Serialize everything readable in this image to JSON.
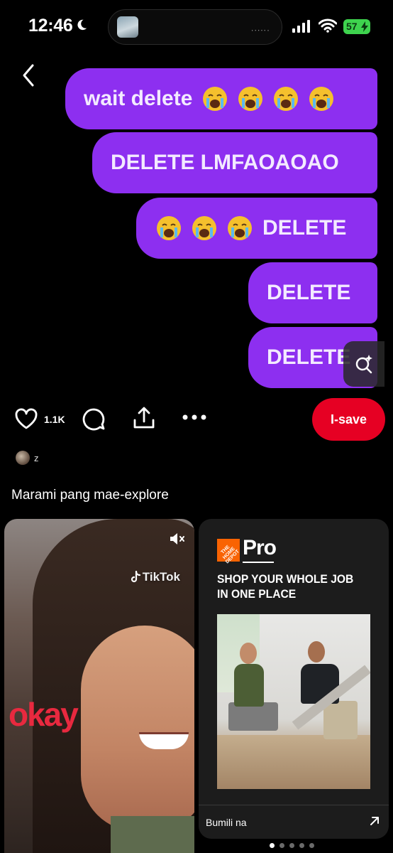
{
  "status_bar": {
    "time": "12:46",
    "battery": "57",
    "icons": [
      "moon-icon",
      "signal-icon",
      "wifi-icon",
      "battery-icon"
    ]
  },
  "pin": {
    "bubbles": [
      {
        "text": "wait delete",
        "emoji_count": 4,
        "emoji_position": "after"
      },
      {
        "text": "DELETE LMFAOAOAO",
        "emoji_count": 0
      },
      {
        "text": "DELETE",
        "emoji_count": 3,
        "emoji_position": "before"
      },
      {
        "text": "DELETE",
        "emoji_count": 0
      },
      {
        "text": "DELETE",
        "emoji_count": 0
      }
    ],
    "bubble_color": "#8d2ff0",
    "emoji": "loudly-crying-face"
  },
  "actions": {
    "like_count": "1.1K",
    "save_label": "I-save",
    "save_color": "#e60023"
  },
  "creator": {
    "name": "z"
  },
  "explore": {
    "heading": "Marami pang mae-explore"
  },
  "cards": {
    "left": {
      "watermark": "TikTok",
      "overlay_text": "okay",
      "overlay_color": "#e8293f"
    },
    "right": {
      "brand_logo": "THE HOME DEPOT",
      "brand": "Pro",
      "headline": "SHOP YOUR WHOLE JOB IN ONE PLACE",
      "cta": "Bumili na",
      "brand_color": "#f96302"
    }
  },
  "pager": {
    "count": 5,
    "active": 1
  }
}
